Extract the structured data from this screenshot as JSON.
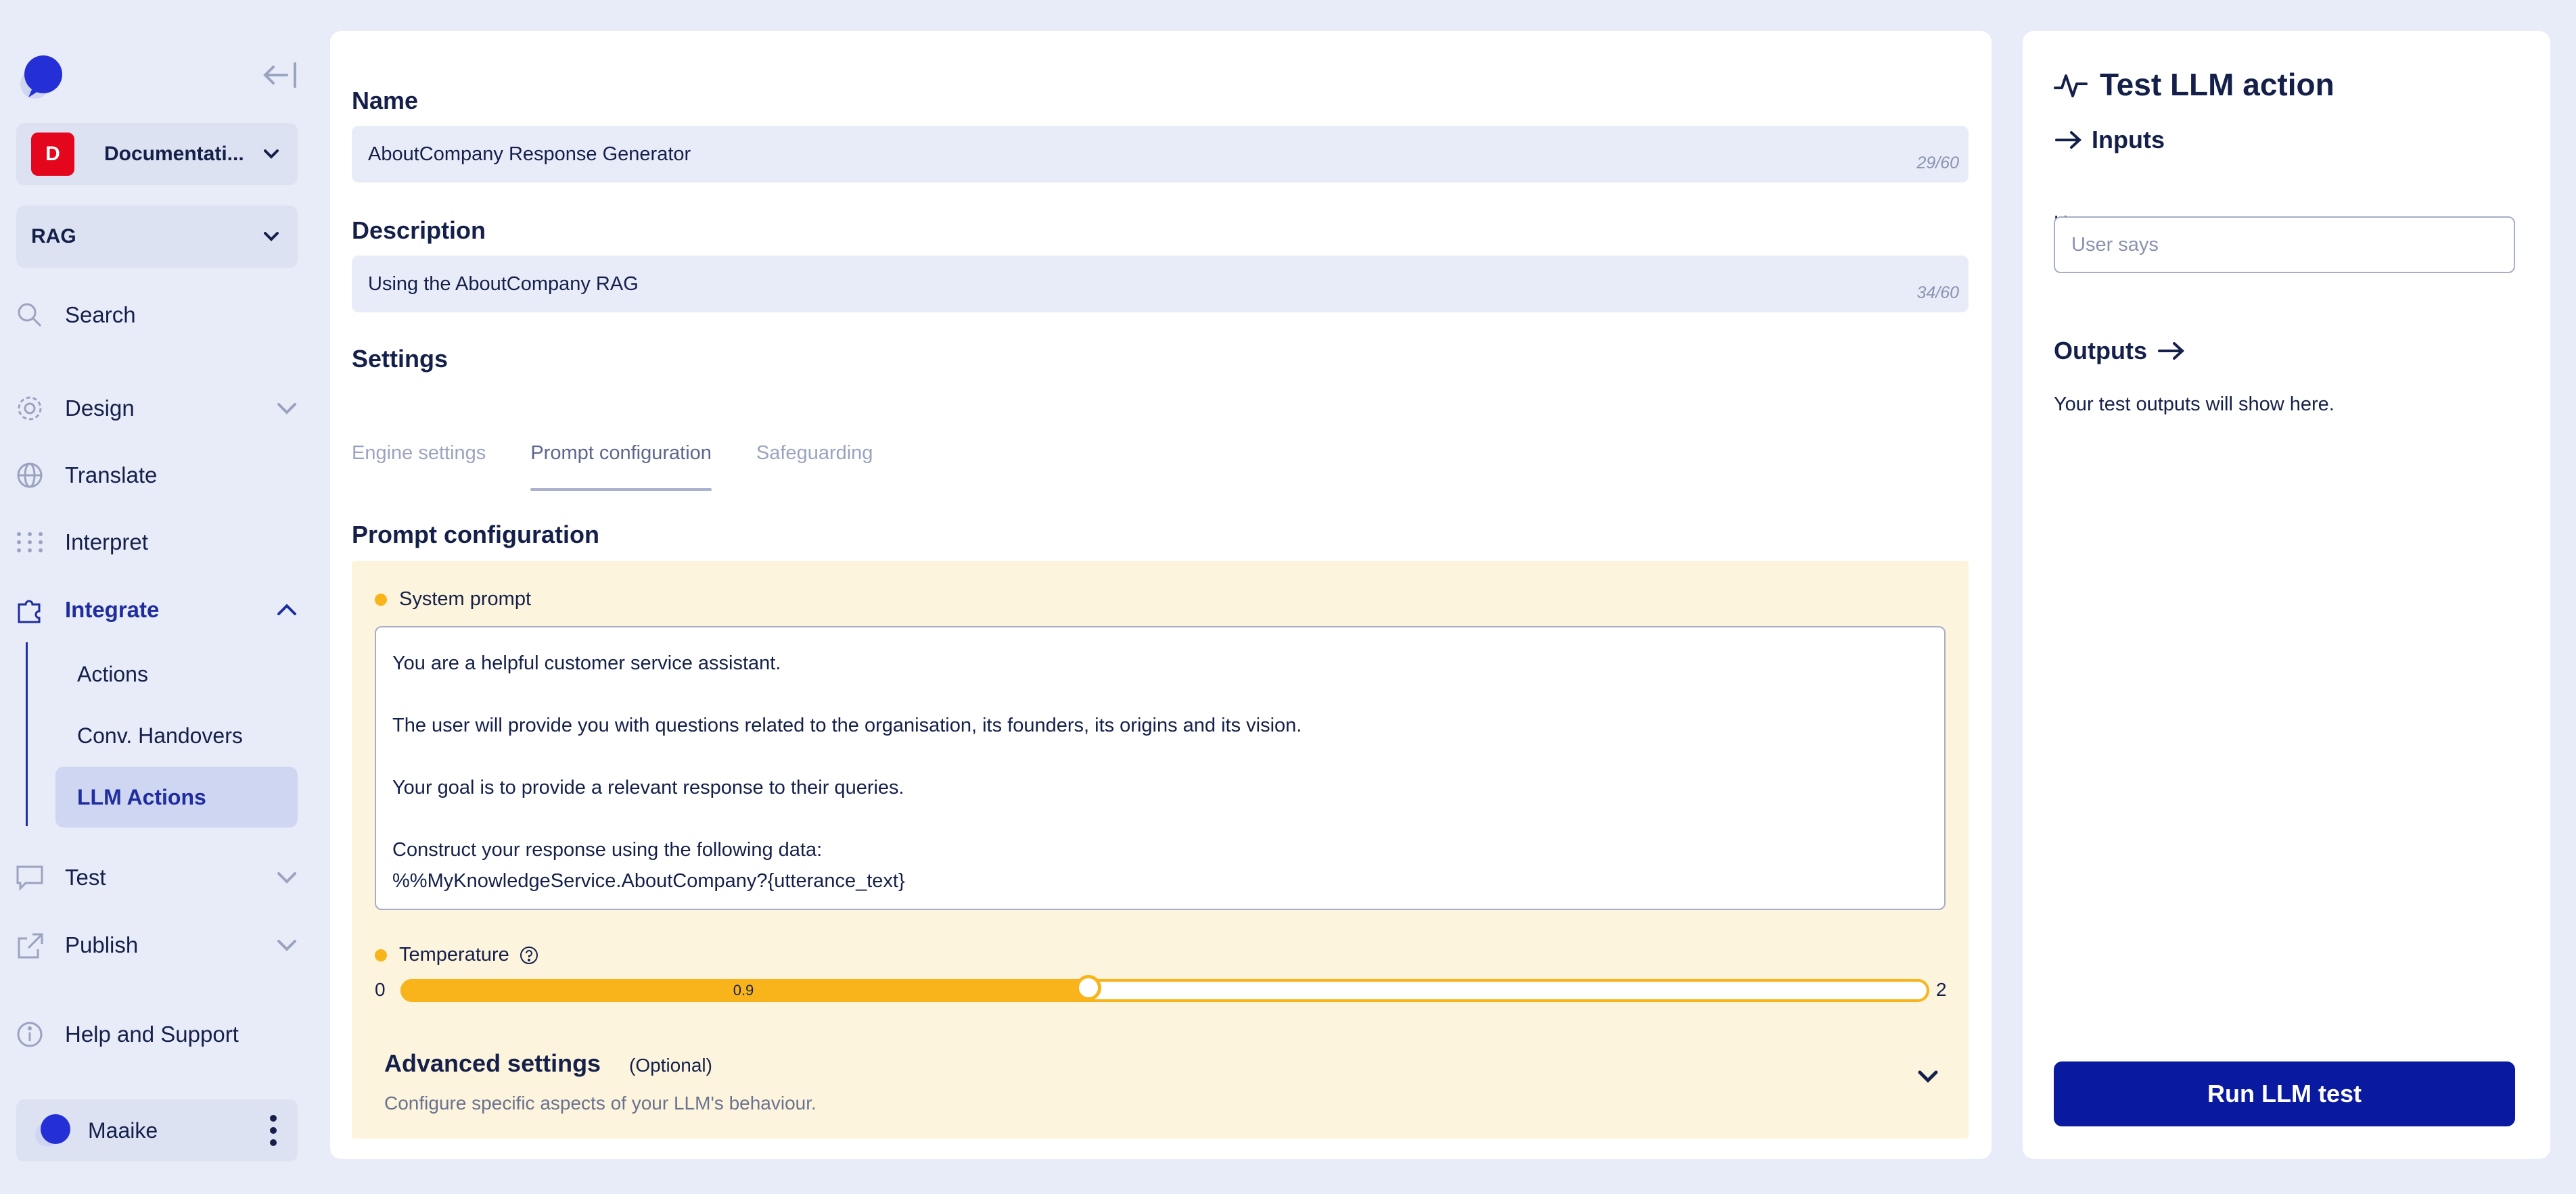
{
  "sidebar": {
    "project": {
      "badge": "D",
      "name": "Documentati...",
      "badge_color": "#e3061c"
    },
    "language": "RAG",
    "nav": {
      "search": "Search",
      "design": "Design",
      "translate": "Translate",
      "interpret": "Interpret",
      "integrate": "Integrate",
      "test": "Test",
      "publish": "Publish",
      "help": "Help and Support"
    },
    "integrate_sub": {
      "actions": "Actions",
      "handovers": "Conv. Handovers",
      "llm_actions": "LLM Actions"
    },
    "user": {
      "name": "Maaike"
    }
  },
  "form": {
    "name": {
      "label": "Name",
      "value": "AboutCompany Response Generator",
      "count": "29/60"
    },
    "description": {
      "label": "Description",
      "value": "Using the AboutCompany RAG",
      "count": "34/60"
    },
    "settings_label": "Settings",
    "tabs": [
      "Engine settings",
      "Prompt configuration",
      "Safeguarding"
    ],
    "active_tab": "Prompt configuration"
  },
  "prompt": {
    "section_title": "Prompt configuration",
    "system_prompt_label": "System prompt",
    "system_prompt": "You are a helpful customer service assistant.\n\nThe user will provide you with questions related to the organisation, its founders, its origins and its vision.\n\nYour goal is to provide a relevant response to their queries.\n\nConstruct your response using the following data:\n%%MyKnowledgeService.AboutCompany?{utterance_text}",
    "temperature": {
      "label": "Temperature",
      "min_label": "0",
      "max_label": "2",
      "value_label": "0.9",
      "min": 0,
      "max": 2,
      "value": 0.9
    }
  },
  "advanced": {
    "title": "Advanced settings",
    "optional": "(Optional)",
    "description": "Configure specific aspects of your LLM's behaviour."
  },
  "test_panel": {
    "title": "Test LLM action",
    "inputs_label": "Inputs",
    "utterance_label": "User utterance",
    "utterance_placeholder": "User says",
    "outputs_label": "Outputs",
    "outputs_message": "Your test outputs will show here.",
    "run_button": "Run LLM test"
  },
  "colors": {
    "accent": "#1f2d9e",
    "button": "#0a1aa0",
    "warning_bg": "#fdf4dd",
    "slider": "#f8b41a"
  },
  "icons": {
    "logo": "chat-bubble-logo",
    "collapse": "collapse-sidebar-icon",
    "search": "search-icon",
    "design": "gear-icon",
    "translate": "globe-icon",
    "interpret": "dots-grid-icon",
    "integrate": "puzzle-icon",
    "test": "chat-icon",
    "publish": "share-icon",
    "help": "info-icon"
  }
}
